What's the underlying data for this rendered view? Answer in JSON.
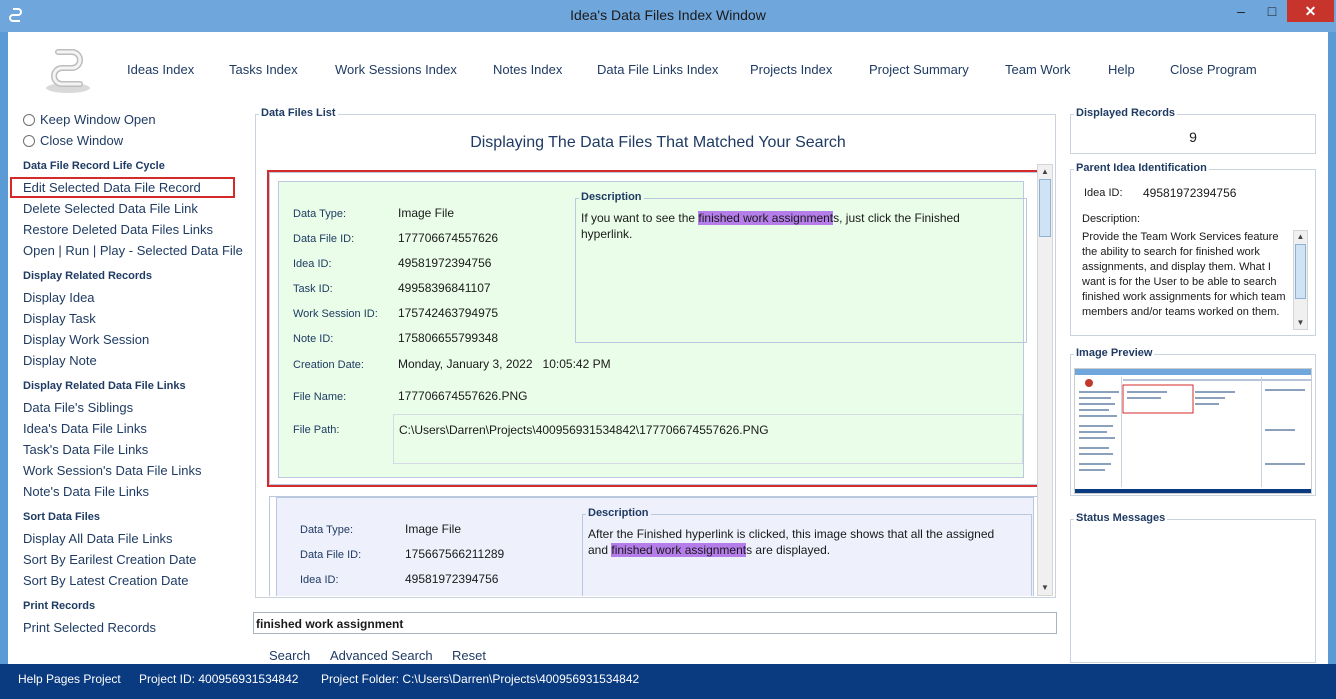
{
  "window": {
    "title": "Idea's Data Files Index Window",
    "min_glyph": "–",
    "max_glyph": "□",
    "close_glyph": "✕"
  },
  "nav": [
    {
      "label": "Ideas Index"
    },
    {
      "label": "Tasks Index"
    },
    {
      "label": "Work Sessions Index"
    },
    {
      "label": "Notes Index"
    },
    {
      "label": "Data File Links Index"
    },
    {
      "label": "Projects Index"
    },
    {
      "label": "Project Summary"
    },
    {
      "label": "Team Work"
    },
    {
      "label": "Help"
    },
    {
      "label": "Close Program"
    }
  ],
  "left": {
    "radio_keep": "Keep Window Open",
    "radio_close": "Close Window",
    "sections": [
      {
        "title": "Data File Record Life Cycle",
        "items": [
          "Edit Selected Data File Record",
          "Delete Selected Data File Link",
          "Restore Deleted Data Files Links",
          "Open | Run | Play - Selected Data File"
        ]
      },
      {
        "title": "Display Related Records",
        "items": [
          "Display Idea",
          "Display Task",
          "Display Work Session",
          "Display Note"
        ]
      },
      {
        "title": "Display Related Data File Links",
        "items": [
          "Data File's Siblings",
          "Idea's Data File Links",
          "Task's Data File Links",
          "Work Session's Data File Links",
          "Note's Data File Links"
        ]
      },
      {
        "title": "Sort Data Files",
        "items": [
          "Display All Data File Links",
          "Sort By Earilest Creation Date",
          "Sort By Latest Creation Date"
        ]
      },
      {
        "title": "Print Records",
        "items": [
          "Print Selected Records"
        ]
      }
    ]
  },
  "main": {
    "group_title": "Data Files List",
    "heading": "Displaying The Data Files That Matched Your Search",
    "labels": {
      "data_type": "Data Type:",
      "data_file_id": "Data File ID:",
      "idea_id": "Idea ID:",
      "task_id": "Task ID:",
      "work_session_id": "Work Session ID:",
      "note_id": "Note ID:",
      "creation_date": "Creation Date:",
      "file_name": "File Name:",
      "file_path": "File Path:",
      "description": "Description"
    },
    "records": [
      {
        "data_type": "Image File",
        "data_file_id": "177706674557626",
        "idea_id": "49581972394756",
        "task_id": "49958396841107",
        "work_session_id": "175742463794975",
        "note_id": "175806655799348",
        "creation_date": "Monday, January 3, 2022   10:05:42 PM",
        "file_name": "177706674557626.PNG",
        "file_path": "C:\\Users\\Darren\\Projects\\400956931534842\\177706674557626.PNG",
        "desc_pre": "If you want to see the ",
        "desc_hl": "finished work assignment",
        "desc_post": "s, just click the Finished hyperlink."
      },
      {
        "data_type": "Image File",
        "data_file_id": "175667566211289",
        "idea_id": "49581972394756",
        "desc_pre": "After the Finished hyperlink is clicked, this image shows that all the assigned and ",
        "desc_hl": "finished work assignment",
        "desc_post": "s are displayed."
      }
    ]
  },
  "search": {
    "value": "finished work assignment",
    "search_label": "Search",
    "advanced_label": "Advanced Search",
    "reset_label": "Reset"
  },
  "right": {
    "displayed_title": "Displayed Records",
    "displayed_count": "9",
    "parent_title": "Parent Idea Identification",
    "idea_id_label": "Idea ID:",
    "idea_id_value": "49581972394756",
    "description_label": "Description:",
    "description_text": "Provide the Team Work Services feature the ability to search for finished work assignments, and display them. What I want is for the User to be able to search finished work assignments for which team members and/or teams worked on them.",
    "preview_title": "Image Preview",
    "status_title": "Status Messages"
  },
  "statusbar": {
    "project": "Help Pages Project",
    "project_id": "Project ID:  400956931534842",
    "project_folder": "Project Folder:  C:\\Users\\Darren\\Projects\\400956931534842"
  },
  "colors": {
    "title_bar": "#6fa6dc",
    "status_bar": "#0a3b80",
    "selection_outline": "#d42a2a",
    "highlight": "#b57dea",
    "card_green": "#e9fde8",
    "card_lavender": "#eef0fb"
  }
}
